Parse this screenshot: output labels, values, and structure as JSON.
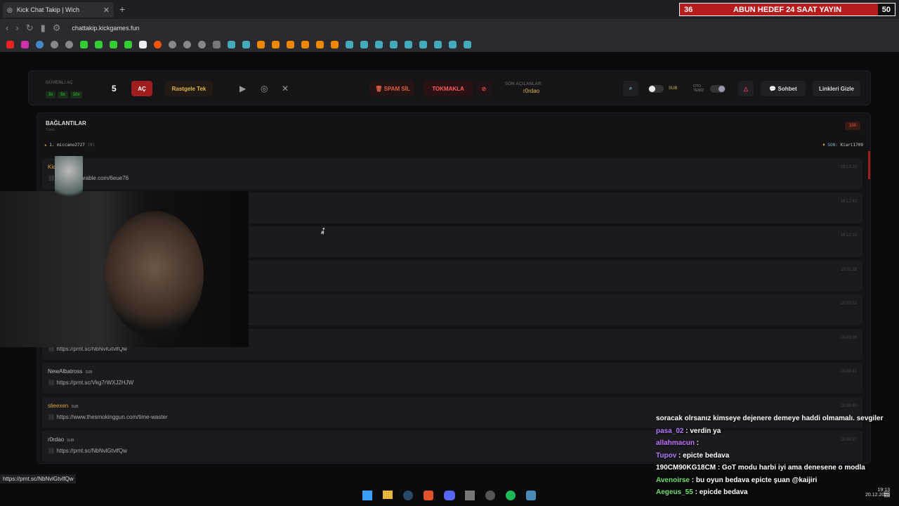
{
  "browser": {
    "tab_title": "Kick Chat Takip | Wich",
    "url": "chattakip.kickgames.fun",
    "stream_overlay": {
      "left": "36",
      "text": "ABUN HEDEF 24 SAAT YAYIN",
      "right": "50"
    }
  },
  "toolbar": {
    "safe_label": "GÜVENLİ AÇ",
    "speed_options": [
      "3x",
      "5x",
      "10x"
    ],
    "count": "5",
    "open_btn": "AÇ",
    "random_btn": "Rastgele Tek",
    "spam_btn": "SPAM SİL",
    "hammer_btn": "TOKMAKLA",
    "last_opened_label": "SON AÇILANLAR",
    "last_opened_user": "r0rdao",
    "sub_label": "SUB",
    "auto_clean_label": "OTO TEMİZ",
    "chat_btn": "Sohbet",
    "hide_links_btn": "Linkleri Gizle"
  },
  "connections": {
    "title": "BAĞLANTILAR",
    "subtitle": "Tümü",
    "count_badge": "100",
    "top_left": "1. miccano2727",
    "top_left_count": "(9)",
    "top_right_label": "SON:",
    "top_right_user": "Kiari1709",
    "rows": [
      {
        "user": "Kiari1709",
        "sub": "",
        "link": "https://wearable.com/6eue76",
        "time": "19:13:15",
        "gold": true
      },
      {
        "user": "",
        "sub": "",
        "link": "",
        "time": "19:12:42",
        "gold": false
      },
      {
        "user": "",
        "sub": "",
        "link": "",
        "time": "19:12:15",
        "gold": false
      },
      {
        "user": "",
        "sub": "",
        "link": "",
        "time": "19:11:28",
        "gold": false
      },
      {
        "user": "",
        "sub": "",
        "link": "",
        "time": "19:09:12",
        "gold": false
      },
      {
        "user": "",
        "sub": "",
        "link": "https://prnt.sc/NbNvlGtvlfQw",
        "time": "19:09:28",
        "gold": false
      },
      {
        "user": "NewAlbatross",
        "sub": "SUB",
        "link": "https://prnt.sc/Vkg7rWXJ2HJW",
        "time": "19:08:41",
        "gold": false
      },
      {
        "user": "slieexen",
        "sub": "SUB",
        "link": "https://www.thesmokinggun.com/time-waster",
        "time": "19:08:40",
        "gold": true
      },
      {
        "user": "r0rdao",
        "sub": "SUB",
        "link": "https://prnt.sc/NbNvlGtvlfQw",
        "time": "19:08:27",
        "gold": false
      }
    ]
  },
  "status_url": "https://prnt.sc/NbNvlGtvlfQw",
  "chat": [
    {
      "user": "",
      "msg": "soracak olrsanız kimseye dejenere demeye haddi olmamalı. sevgiler",
      "color": "#ffffff"
    },
    {
      "user": "pasa_02",
      "msg": " : verdin ya",
      "color": "#b37bff"
    },
    {
      "user": "allahmacun",
      "msg": " : ",
      "color": "#c774ff"
    },
    {
      "user": "Tupov",
      "msg": " : epicte bedava",
      "color": "#b37bff"
    },
    {
      "user": "190CM90KG18CM",
      "msg": " : GoT modu harbi iyi ama denesene o modla",
      "color": "#ffffff"
    },
    {
      "user": "Avenoirse",
      "msg": " : bu oyun bedava epicte şuan @kaijiri",
      "color": "#6fe06f"
    },
    {
      "user": "Aegeus_55",
      "msg": " : epicde bedava",
      "color": "#6fe06f"
    }
  ],
  "clock": {
    "time": "19:13",
    "date": "20.12.2025"
  },
  "colors": {
    "accent_red": "#c62828",
    "gold": "#d7a63a",
    "green_chip": "#3c3"
  }
}
